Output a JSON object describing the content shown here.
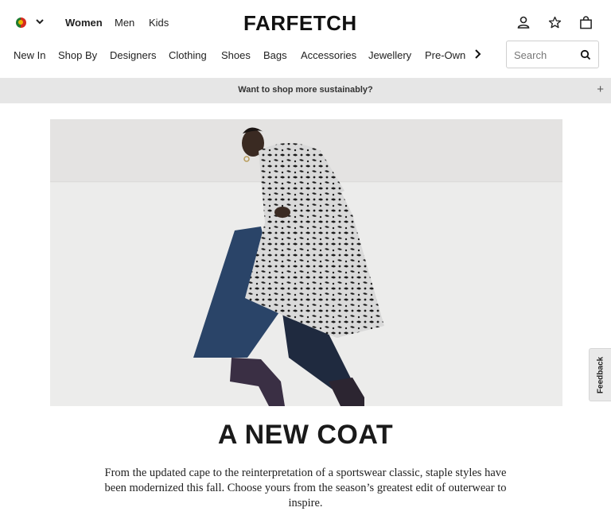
{
  "header": {
    "country_flag": "portugal-flag-icon",
    "genders": [
      "Women",
      "Men",
      "Kids"
    ],
    "active_gender": "Women",
    "logo": "FARFETCH"
  },
  "nav": {
    "items": [
      "New In",
      "Shop By",
      "Designers",
      "Clothing",
      "Shoes",
      "Bags",
      "Accessories",
      "Jewellery",
      "Pre-Own"
    ],
    "search_placeholder": "Search"
  },
  "banner": {
    "text": "Want to shop more sustainably?",
    "expand": "+"
  },
  "hero": {
    "image_description": "model-in-leopard-print-coat"
  },
  "content": {
    "headline": "A NEW COAT",
    "body": "From the updated cape to the reinterpretation of a sportswear classic, staple styles have been modernized this fall. Choose yours from the season’s greatest edit of outerwear to inspire."
  },
  "feedback": {
    "label": "Feedback"
  },
  "colors": {
    "banner_bg": "#e6e6e6",
    "text": "#222222"
  }
}
